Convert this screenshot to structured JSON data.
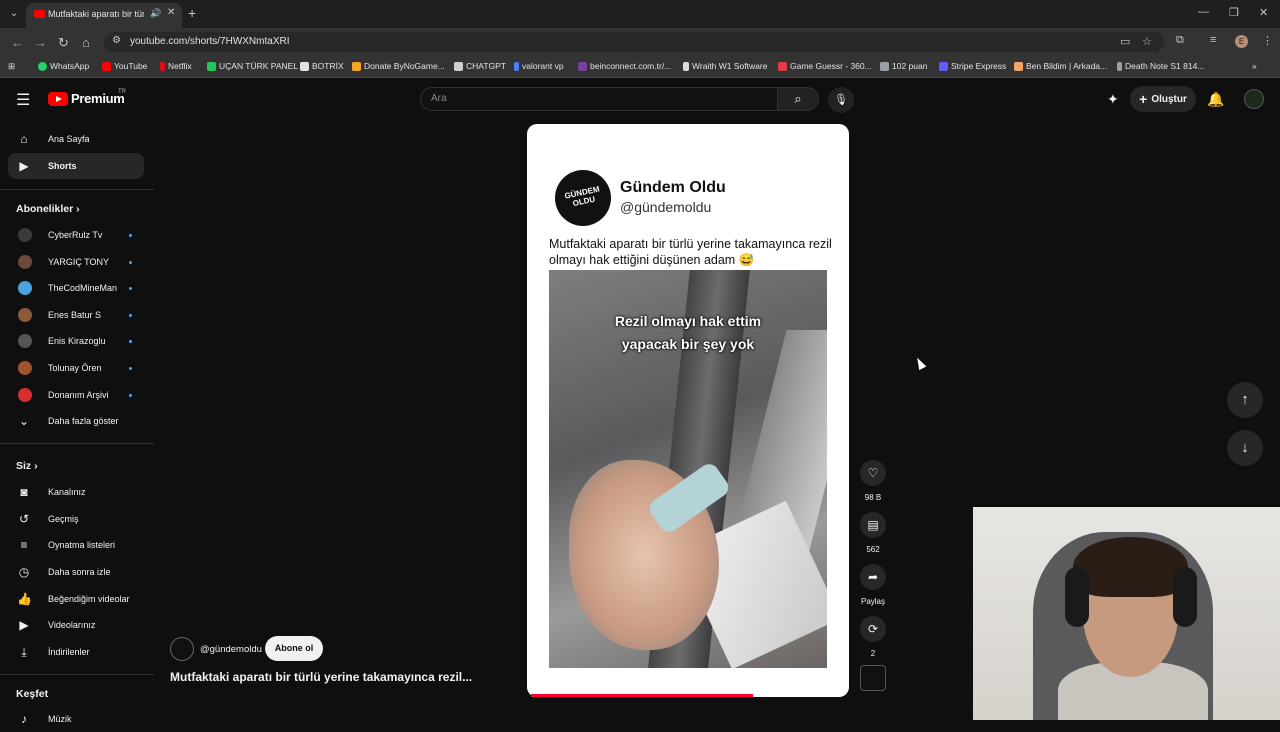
{
  "browser": {
    "tab_title": "Mutfaktaki aparatı bir türlü",
    "url": "youtube.com/shorts/7HWXNmtaXRI",
    "bookmarks": [
      {
        "label": "WhatsApp",
        "color": "#25d366"
      },
      {
        "label": "YouTube",
        "color": "#ff0000"
      },
      {
        "label": "Netflix",
        "color": "#e50914"
      },
      {
        "label": "UÇAN TÜRK PANEL",
        "color": "#22c55e"
      },
      {
        "label": "BOTRİX",
        "color": "#e3e3e3"
      },
      {
        "label": "Donate ByNoGame...",
        "color": "#f5a623"
      },
      {
        "label": "CHATGPT",
        "color": "#cfcfcf"
      },
      {
        "label": "valorant vp",
        "color": "#4f7cff"
      },
      {
        "label": "beinconnect.com.tr/...",
        "color": "#7b3fa0"
      },
      {
        "label": "Wraith W1 Software",
        "color": "#dcdcdc"
      },
      {
        "label": "Game Guessr - 360...",
        "color": "#e63946"
      },
      {
        "label": "102 puan",
        "color": "#9aa0a6"
      },
      {
        "label": "Stripe Express",
        "color": "#635bff"
      },
      {
        "label": "Ben Bildim | Arkada...",
        "color": "#f4a261"
      },
      {
        "label": "Death Note S1 814...",
        "color": "#9aa0a6"
      }
    ]
  },
  "header": {
    "logo_text": "Premium",
    "country": "TR",
    "search_placeholder": "Ara",
    "create_label": "Oluştur"
  },
  "sidebar": {
    "main": [
      {
        "label": "Ana Sayfa",
        "icon": "home-icon"
      },
      {
        "label": "Shorts",
        "icon": "shorts-icon"
      }
    ],
    "subscriptions_title": "Abonelikler",
    "subscriptions": [
      {
        "label": "CyberRulz Tv",
        "color": "#3a3a3a"
      },
      {
        "label": "YARGIÇ TONY",
        "color": "#6b4a3a"
      },
      {
        "label": "TheCodMineMan",
        "color": "#4aa3df"
      },
      {
        "label": "Enes Batur S",
        "color": "#8b5a3c"
      },
      {
        "label": "Enis Kirazoglu",
        "color": "#555555"
      },
      {
        "label": "Tolunay Ören",
        "color": "#a0522d"
      },
      {
        "label": "Donanım Arşivi",
        "color": "#d32f2f"
      }
    ],
    "show_more": "Daha fazla göster",
    "you_title": "Siz",
    "you_items": [
      {
        "label": "Kanalınız",
        "icon": "channel-icon"
      },
      {
        "label": "Geçmiş",
        "icon": "history-icon"
      },
      {
        "label": "Oynatma listeleri",
        "icon": "playlist-icon"
      },
      {
        "label": "Daha sonra izle",
        "icon": "clock-icon"
      },
      {
        "label": "Beğendiğim videolar",
        "icon": "like-icon"
      },
      {
        "label": "Videolarınız",
        "icon": "video-icon"
      },
      {
        "label": "İndirilenler",
        "icon": "download-icon"
      }
    ],
    "explore_title": "Keşfet",
    "explore_first": "Müzik"
  },
  "short": {
    "card_name": "Gündem Oldu",
    "card_handle": "@gündemoldu",
    "avatar_text": "GÜNDEM OLDU",
    "caption": "Mutfaktaki aparatı bir türlü yerine takamayınca rezil olmayı hak ettiğini düşünen adam 😅",
    "overlay_line1": "Rezil olmayı hak ettim",
    "overlay_line2": "yapacak bir şey yok",
    "channel_handle": "@gündemoldu",
    "subscribe_label": "Abone ol",
    "title": "Mutfaktaki aparatı bir türlü yerine takamayınca rezil...",
    "progress": 0.69
  },
  "actions": {
    "likes": "98 B",
    "comments": "562",
    "share": "Paylaş",
    "remix": "2"
  }
}
